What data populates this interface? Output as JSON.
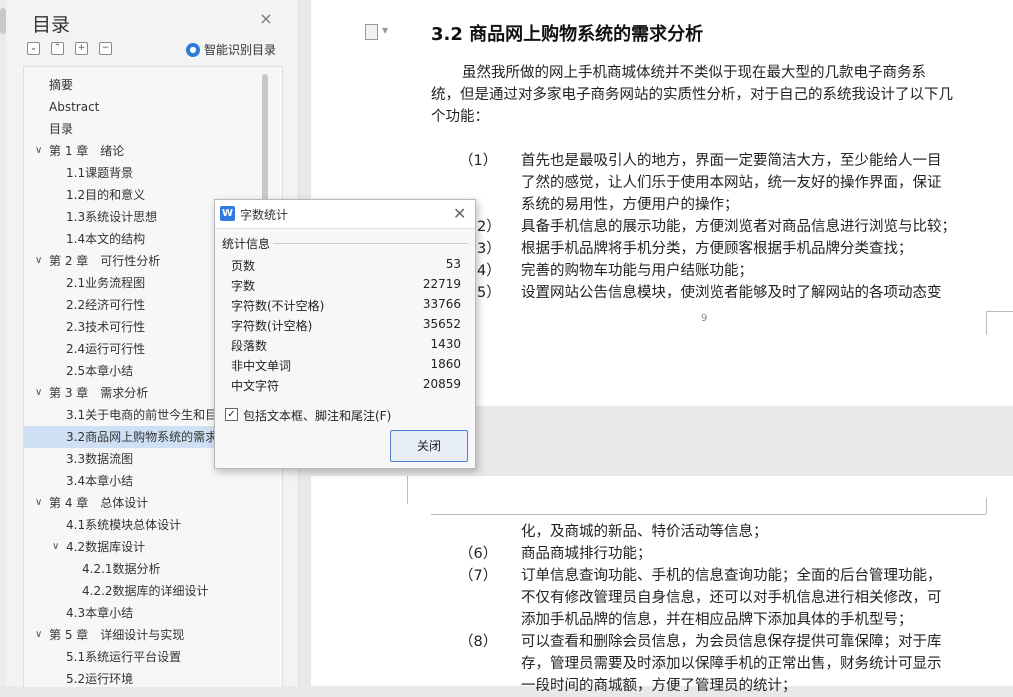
{
  "outline": {
    "title": "目录",
    "smart_button": "智能识别目录",
    "items": [
      {
        "label": "摘要",
        "level": 0,
        "caret": ""
      },
      {
        "label": "Abstract",
        "level": 0,
        "caret": ""
      },
      {
        "label": "目录",
        "level": 0,
        "caret": ""
      },
      {
        "label": "第 1 章　绪论",
        "level": 0,
        "caret": "∨"
      },
      {
        "label": "1.1课题背景",
        "level": 1,
        "caret": ""
      },
      {
        "label": "1.2目的和意义",
        "level": 1,
        "caret": ""
      },
      {
        "label": "1.3系统设计思想",
        "level": 1,
        "caret": ""
      },
      {
        "label": "1.4本文的结构",
        "level": 1,
        "caret": ""
      },
      {
        "label": "第 2 章　可行性分析",
        "level": 0,
        "caret": "∨"
      },
      {
        "label": "2.1业务流程图",
        "level": 1,
        "caret": ""
      },
      {
        "label": "2.2经济可行性",
        "level": 1,
        "caret": ""
      },
      {
        "label": "2.3技术可行性",
        "level": 1,
        "caret": ""
      },
      {
        "label": "2.4运行可行性",
        "level": 1,
        "caret": ""
      },
      {
        "label": "2.5本章小结",
        "level": 1,
        "caret": ""
      },
      {
        "label": "第 3 章　需求分析",
        "level": 0,
        "caret": "∨"
      },
      {
        "label": "3.1关于电商的前世今生和目",
        "level": 1,
        "caret": ""
      },
      {
        "label": "3.2商品网上购物系统的需求",
        "level": 1,
        "caret": "",
        "selected": true
      },
      {
        "label": "3.3数据流图",
        "level": 1,
        "caret": ""
      },
      {
        "label": "3.4本章小结",
        "level": 1,
        "caret": ""
      },
      {
        "label": "第 4 章　总体设计",
        "level": 0,
        "caret": "∨"
      },
      {
        "label": "4.1系统模块总体设计",
        "level": 1,
        "caret": ""
      },
      {
        "label": "4.2数据库设计",
        "level": 1,
        "caret": "∨"
      },
      {
        "label": "4.2.1数据分析",
        "level": 2,
        "caret": ""
      },
      {
        "label": "4.2.2数据库的详细设计",
        "level": 2,
        "caret": ""
      },
      {
        "label": "4.3本章小结",
        "level": 1,
        "caret": ""
      },
      {
        "label": "第 5 章　详细设计与实现",
        "level": 0,
        "caret": "∨"
      },
      {
        "label": "5.1系统运行平台设置",
        "level": 1,
        "caret": ""
      },
      {
        "label": "5.2运行环境",
        "level": 1,
        "caret": ""
      }
    ]
  },
  "document": {
    "heading": "3.2   商品网上购物系统的需求分析",
    "page1_lines": [
      "虽然我所做的网上手机商城体统并不类似于现在最大型的几款电子商务系",
      "统，但是通过对多家电子商务网站的实质性分析，对于自己的系统我设计了以下几",
      "个功能："
    ],
    "page1_items": [
      {
        "num": "（1）",
        "lines": [
          "首先也是最吸引人的地方，界面一定要简洁大方，至少能给人一目",
          "了然的感觉，让人们乐于使用本网站，统一友好的操作界面，保证",
          "系统的易用性，方便用户的操作；"
        ]
      },
      {
        "num": "2）",
        "lines": [
          "具备手机信息的展示功能，方便浏览者对商品信息进行浏览与比较；"
        ]
      },
      {
        "num": "3）",
        "lines": [
          "根据手机品牌将手机分类，方便顾客根据手机品牌分类查找；"
        ]
      },
      {
        "num": "4）",
        "lines": [
          "完善的购物车功能与用户结账功能；"
        ]
      },
      {
        "num": "5）",
        "lines": [
          "设置网站公告信息模块，使浏览者能够及时了解网站的各项动态变"
        ]
      }
    ],
    "page_number": "9",
    "page2_lines": [
      {
        "num": "",
        "text": "化，及商城的新品、特价活动等信息；"
      },
      {
        "num": "（6）",
        "text": "商品商城排行功能；"
      },
      {
        "num": "（7）",
        "text": "订单信息查询功能、手机的信息查询功能；全面的后台管理功能，"
      },
      {
        "num": "",
        "text": "不仅有修改管理员自身信息，还可以对手机信息进行相关修改，可"
      },
      {
        "num": "",
        "text": "添加手机品牌的信息，并在相应品牌下添加具体的手机型号；"
      },
      {
        "num": "（8）",
        "text": "可以查看和删除会员信息，为会员信息保存提供可靠保障；对于库"
      },
      {
        "num": "",
        "text": "存，管理员需要及时添加以保障手机的正常出售，财务统计可显示"
      },
      {
        "num": "",
        "text": "一段时间的商城额，方便了管理员的统计；"
      }
    ]
  },
  "dialog": {
    "title": "字数统计",
    "section": "统计信息",
    "stats": [
      {
        "label": "页数",
        "value": "53"
      },
      {
        "label": "字数",
        "value": "22719"
      },
      {
        "label": "字符数(不计空格)",
        "value": "33766"
      },
      {
        "label": "字符数(计空格)",
        "value": "35652"
      },
      {
        "label": "段落数",
        "value": "1430"
      },
      {
        "label": "非中文单词",
        "value": "1860"
      },
      {
        "label": "中文字符",
        "value": "20859"
      }
    ],
    "checkbox_label": "包括文本框、脚注和尾注(F)",
    "checkbox_checked": true,
    "close_button": "关闭"
  }
}
